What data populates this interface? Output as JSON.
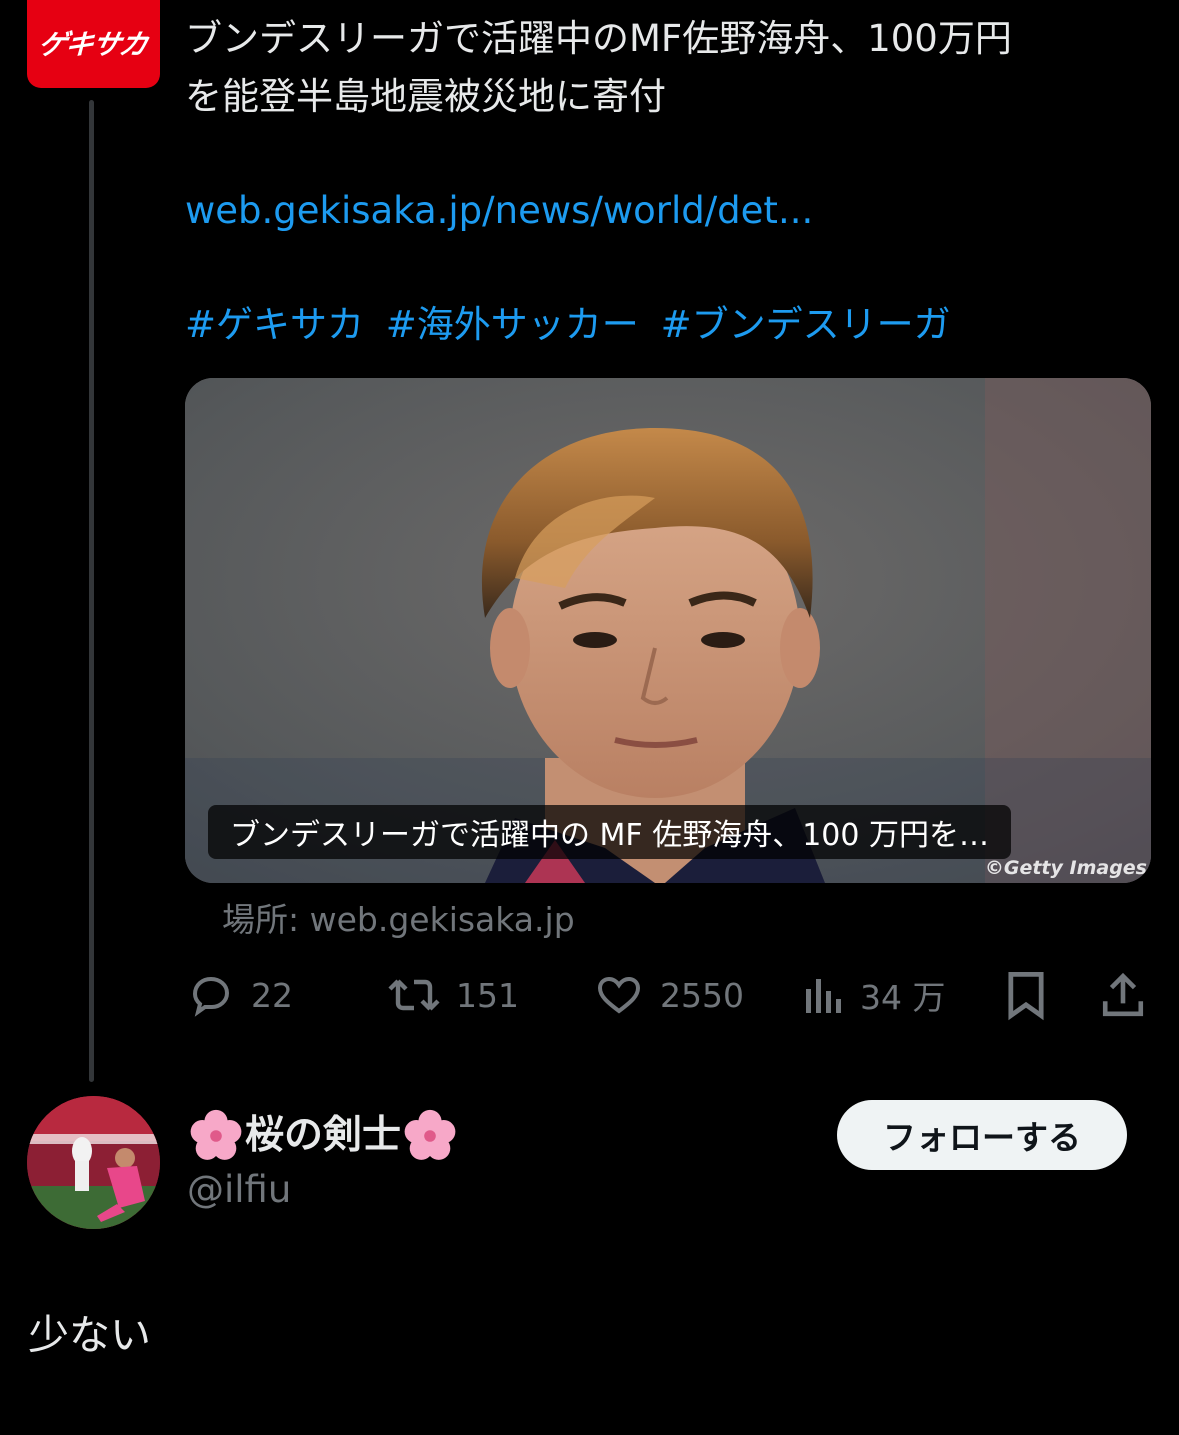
{
  "tweet": {
    "author_logo_text": "ゲキサカ",
    "text_line1": "ブンデスリーガで活躍中のMF佐野海舟、100万円",
    "text_line2": "を能登半島地震被災地に寄付",
    "link": "web.gekisaka.jp/news/world/det...",
    "hashtags": [
      "#ゲキサカ",
      "#海外サッカー",
      "#ブンデスリーガ"
    ],
    "card": {
      "title": "ブンデスリーガで活躍中の MF 佐野海舟、100 万円を…",
      "credit": "©Getty Images"
    },
    "source": "場所: web.gekisaka.jp",
    "actions": {
      "replies": "22",
      "retweets": "151",
      "likes": "2550",
      "views": "34 万"
    }
  },
  "reply": {
    "display_name": "桜の剣士",
    "handle": "@ilfiu",
    "follow_label": "フォローする",
    "text": "少ない"
  },
  "colors": {
    "background": "#000000",
    "link": "#1d9bf0",
    "muted": "#71767b",
    "text": "#e7e9ea",
    "brand_red": "#e60012",
    "follow_bg": "#eff3f4"
  },
  "icons": [
    "reply-icon",
    "retweet-icon",
    "like-icon",
    "views-icon",
    "bookmark-icon",
    "share-icon",
    "cherry-blossom-icon"
  ]
}
